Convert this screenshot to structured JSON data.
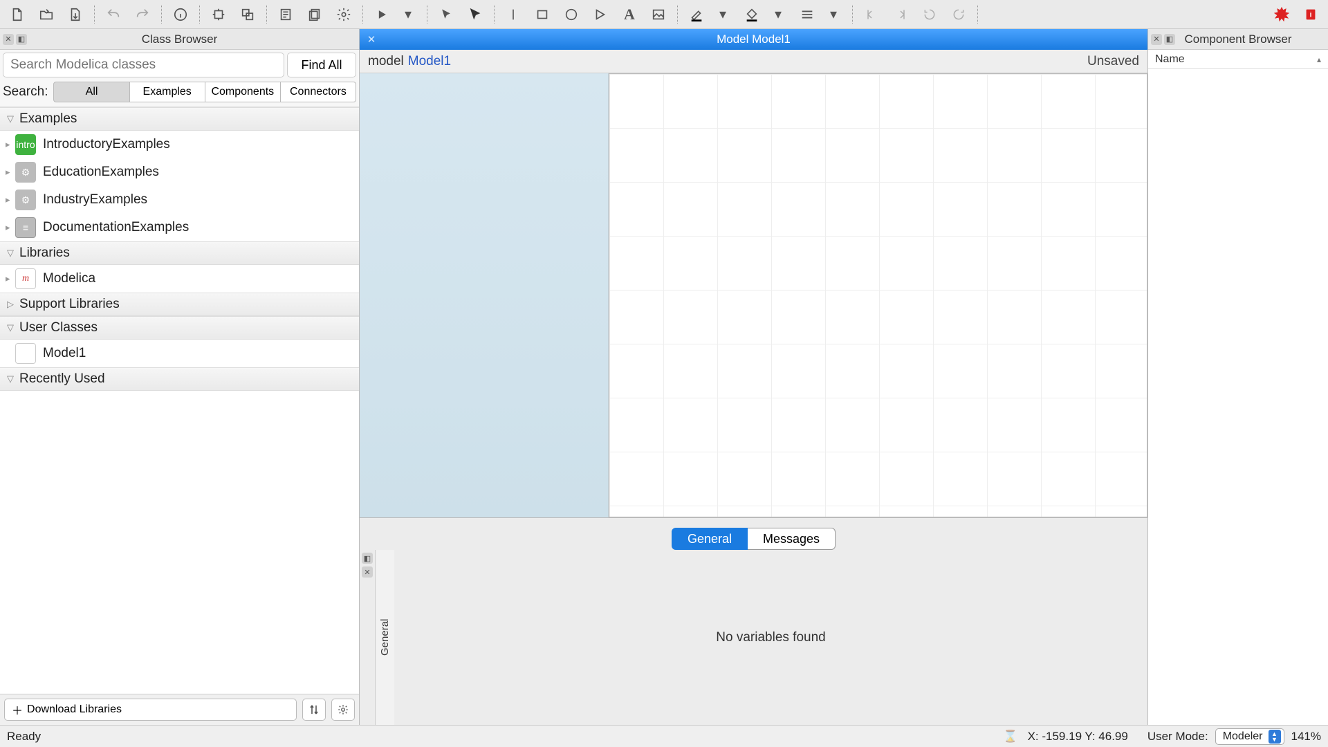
{
  "toolbar": {
    "icons": [
      "new-file-icon",
      "open-file-icon",
      "save-icon",
      "sep",
      "undo-icon",
      "redo-icon",
      "sep",
      "info-icon",
      "sep",
      "component-icon",
      "duplicate-icon",
      "sep",
      "text-view-icon",
      "copy-doc-icon",
      "settings-icon",
      "sep",
      "play-icon",
      "play-dropdown",
      "sep",
      "arrow-cursor-icon",
      "arrow-cursor2-icon",
      "sep",
      "line-icon",
      "rect-icon",
      "ellipse-icon",
      "polygon-icon",
      "text-tool-icon",
      "image-icon",
      "sep",
      "line-color-icon",
      "line-color-dropdown",
      "fill-color-icon",
      "fill-color-dropdown",
      "line-style-icon",
      "line-style-dropdown",
      "sep",
      "skip-back-icon",
      "skip-fwd-icon",
      "rotate-ccw-icon",
      "rotate-cw-icon",
      "sep",
      "spacer",
      "wolfram-icon",
      "help-book-icon"
    ]
  },
  "classBrowser": {
    "title": "Class Browser",
    "searchPlaceholder": "Search Modelica classes",
    "findAll": "Find All",
    "searchLabel": "Search:",
    "filters": {
      "all": "All",
      "examples": "Examples",
      "components": "Components",
      "connectors": "Connectors"
    },
    "sections": {
      "examples": "Examples",
      "libraries": "Libraries",
      "support": "Support Libraries",
      "user": "User Classes",
      "recent": "Recently Used"
    },
    "examplesItems": {
      "intro": "IntroductoryExamples",
      "edu": "EducationExamples",
      "ind": "IndustryExamples",
      "doc": "DocumentationExamples"
    },
    "librariesItems": {
      "modelica": "Modelica"
    },
    "userItems": {
      "model1": "Model1"
    },
    "downloadLibraries": "Download Libraries"
  },
  "editor": {
    "tabTitle": "Model Model1",
    "modelKeyword": "model",
    "modelName": "Model1",
    "unsaved": "Unsaved"
  },
  "bottomPanel": {
    "tabs": {
      "general": "General",
      "messages": "Messages"
    },
    "vtab": "General",
    "empty": "No variables found"
  },
  "componentBrowser": {
    "title": "Component Browser",
    "nameCol": "Name"
  },
  "status": {
    "ready": "Ready",
    "coords": "X: -159.19  Y: 46.99",
    "userModeLabel": "User Mode:",
    "mode": "Modeler",
    "zoom": "141%"
  }
}
